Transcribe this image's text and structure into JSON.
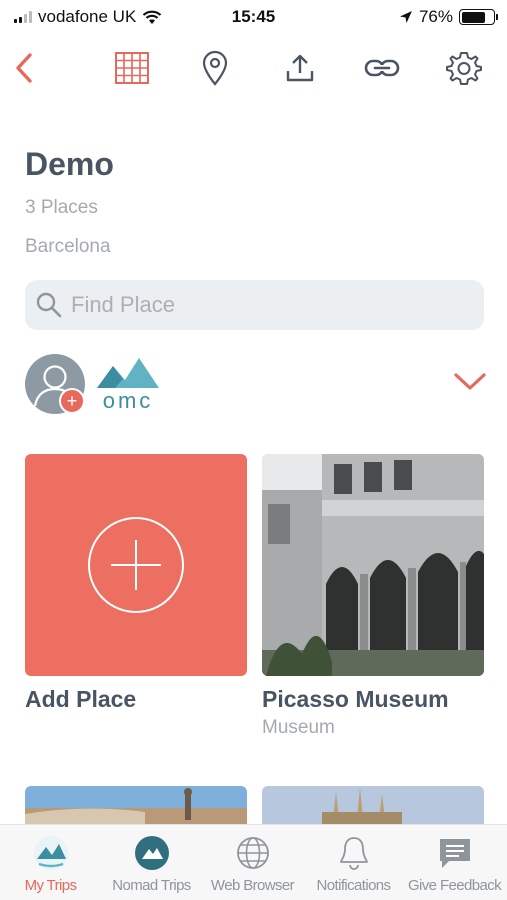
{
  "status_bar": {
    "carrier": "vodafone UK",
    "time": "15:45",
    "battery": "76%",
    "battery_level": 0.76
  },
  "toolbar": {
    "icons": [
      "back-chevron-icon",
      "grid-icon",
      "map-pin-icon",
      "share-icon",
      "link-icon",
      "settings-gear-icon"
    ]
  },
  "trip": {
    "title": "Demo",
    "places_count": "3 Places",
    "city": "Barcelona"
  },
  "search": {
    "placeholder": "Find Place"
  },
  "members": {
    "group_logo_text": "omc"
  },
  "places": [
    {
      "title": "Add Place",
      "subtitle": ""
    },
    {
      "title": "Picasso Museum",
      "subtitle": "Museum"
    }
  ],
  "tabbar": {
    "tabs": [
      {
        "label": "My Trips",
        "active": true
      },
      {
        "label": "Nomad Trips",
        "active": false
      },
      {
        "label": "Web Browser",
        "active": false
      },
      {
        "label": "Notifications",
        "active": false
      },
      {
        "label": "Give Feedback",
        "active": false
      }
    ]
  },
  "colors": {
    "accent": "#e8685c",
    "add_tile": "#ec6f61",
    "teal": "#4a9fb0",
    "text_dark": "#4a5563",
    "text_muted": "#a4aab0"
  }
}
